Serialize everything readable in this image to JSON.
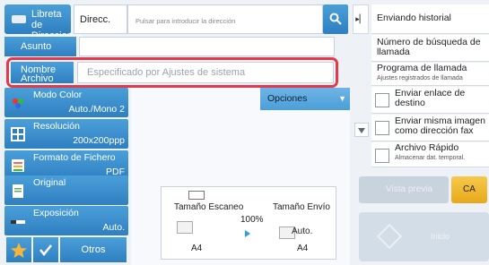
{
  "top": {
    "address_book": "Libreta de Direcciones",
    "direcc": "Direcc.",
    "address_placeholder": "Pulsar para introducir la dirección"
  },
  "fields": {
    "asunto_label": "Asunto",
    "asunto_value": "",
    "nombre_label": "Nombre Archivo",
    "nombre_placeholder": "Especificado por Ajustes de sistema"
  },
  "left_buttons": [
    {
      "title": "Modo Color",
      "value": "Auto./Mono 2"
    },
    {
      "title": "Resolución",
      "value": "200x200ppp"
    },
    {
      "title": "Formato de Fichero",
      "value": "PDF"
    },
    {
      "title": "Original",
      "value": ""
    },
    {
      "title": "Exposición",
      "value": "Auto."
    }
  ],
  "opciones": "Opciones",
  "scan": {
    "scan_size_label": "Tamaño Escaneo",
    "send_size_label": "Tamaño Envío",
    "ratio": "100%",
    "auto": "Auto.",
    "scan_paper": "A4",
    "send_paper": "A4"
  },
  "toggle_icon": "▸▏",
  "right_panel": {
    "history": "Enviando historial",
    "search_number": "Número de búsqueda de llamada",
    "program": "Programa de llamada",
    "program_sub": "Ajustes registrados de llamada",
    "send_dest": "Enviar enlace de destino",
    "send_same_image": "Enviar misma imagen como dirección  fax",
    "quick_file": "Archivo Rápido",
    "quick_file_sub": "Almacenar dat. temporal."
  },
  "bottom": {
    "otros": "Otros",
    "ca": "CA",
    "preview": "Vista previa",
    "start": "Inicio"
  },
  "colors": {
    "accent_blue": "#2f7fc1",
    "highlight_red": "#e23a4a",
    "ca_yellow": "#e8a81b"
  }
}
